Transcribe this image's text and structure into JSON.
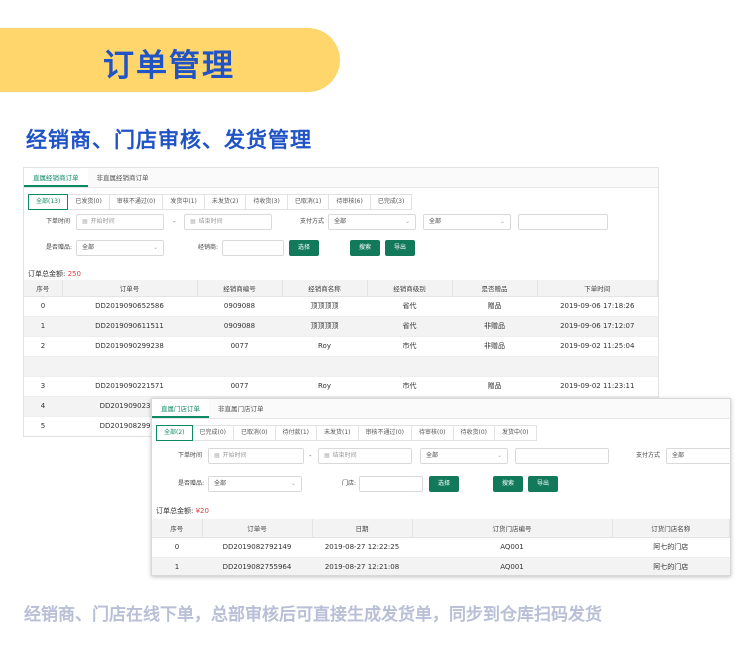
{
  "header": {
    "title": "订单管理",
    "subtitle": "经销商、门店审核、发货管理",
    "caption": "经销商、门店在线下单，总部审核后可直接生成发货单，同步到仓库扫码发货"
  },
  "colors": {
    "accent": "#127a5a",
    "title_blue": "#1f53c6",
    "banner": "#ffd66b",
    "amount_red": "#e4393c"
  },
  "panel_a": {
    "tabs": [
      "直属经销商订单",
      "非直属经销商订单"
    ],
    "statuses": [
      "全部(13)",
      "已发货(0)",
      "审核不通过(0)",
      "发货中(1)",
      "未发货(2)",
      "待收货(3)",
      "已取消(1)",
      "待审核(6)",
      "已完成(3)"
    ],
    "form": {
      "order_time_label": "下单时间",
      "start_placeholder": "开始时间",
      "range_sep": "-",
      "end_placeholder": "结束时间",
      "pay_method_label": "支付方式",
      "pay_method_value": "全部",
      "select2_value": "全部",
      "gift_label": "是否赠品:",
      "gift_value": "全部",
      "dealer_label": "经销商:",
      "choose_btn": "选择",
      "search_btn": "搜索",
      "export_btn": "导出"
    },
    "total_label": "订单总金额: ",
    "total_amount": "250",
    "columns": [
      "序号",
      "订单号",
      "经销商编号",
      "经销商名称",
      "经销商级别",
      "是否赠品",
      "下单时间"
    ],
    "rows": [
      [
        "0",
        "DD2019090652586",
        "0909088",
        "顶顶顶顶",
        "省代",
        "赠品",
        "2019-09-06 17:18:26"
      ],
      [
        "1",
        "DD2019090611511",
        "0909088",
        "顶顶顶顶",
        "省代",
        "非赠品",
        "2019-09-06 17:12:07"
      ],
      [
        "2",
        "DD2019090299238",
        "0077",
        "Roy",
        "市代",
        "非赠品",
        "2019-09-02 11:25:04"
      ],
      [
        "3",
        "DD2019090221571",
        "0077",
        "Roy",
        "市代",
        "赠品",
        "2019-09-02 11:23:11"
      ],
      [
        "4",
        "DD20190902378",
        "",
        "",
        "",
        "",
        ""
      ],
      [
        "5",
        "DD20190829919",
        "",
        "",
        "",
        "",
        ""
      ]
    ]
  },
  "panel_b": {
    "tabs": [
      "直属门店订单",
      "非直属门店订单"
    ],
    "statuses": [
      "全部(2)",
      "已完成(0)",
      "已取消(0)",
      "待付款(1)",
      "未发货(1)",
      "审核不通过(0)",
      "待审核(0)",
      "待收货(0)",
      "发货中(0)"
    ],
    "form": {
      "order_time_label": "下单时间",
      "start_placeholder": "开始时间",
      "range_sep": "-",
      "end_placeholder": "结束时间",
      "select1_value": "全部",
      "pay_method_label": "支付方式",
      "pay_method_value": "全部",
      "gift_label": "是否赠品:",
      "gift_value": "全部",
      "store_label": "门店:",
      "choose_btn": "选择",
      "search_btn": "搜索",
      "export_btn": "导出"
    },
    "total_label": "订单总金额: ",
    "total_amount": "¥20",
    "columns": [
      "序号",
      "订单号",
      "日期",
      "订货门店编号",
      "订货门店名称"
    ],
    "rows": [
      [
        "0",
        "DD2019082792149",
        "2019-08-27 12:22:25",
        "AQ001",
        "阿七的门店"
      ],
      [
        "1",
        "DD2019082755964",
        "2019-08-27 12:21:08",
        "AQ001",
        "阿七的门店"
      ]
    ]
  }
}
